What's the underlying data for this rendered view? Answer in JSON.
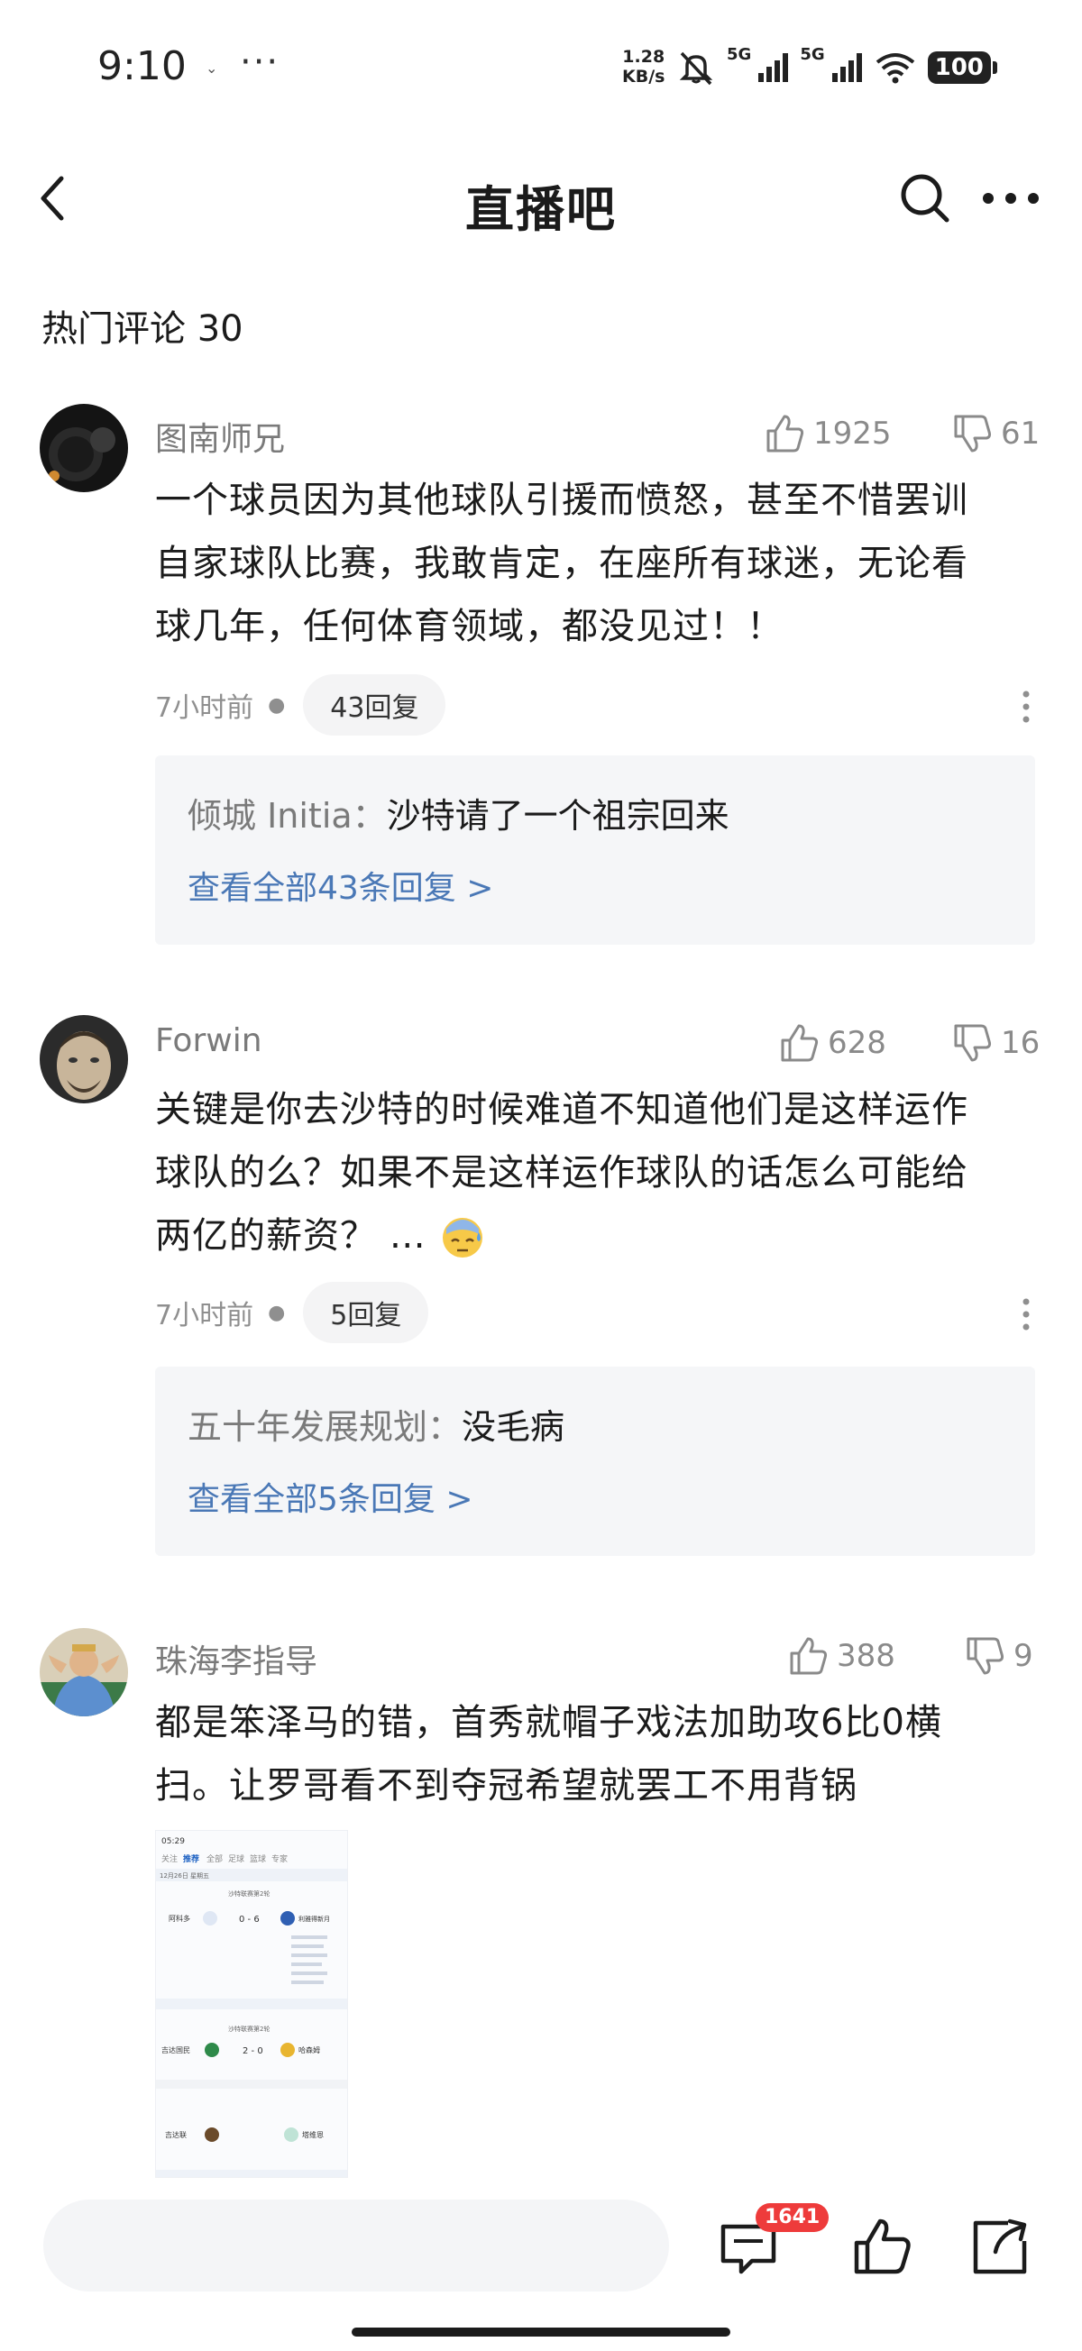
{
  "status": {
    "time": "9:10",
    "small_icon": "⌄",
    "dots": "···",
    "net_speed_value": "1.28",
    "net_speed_unit": "KB/s",
    "sig1": "5G",
    "sig2": "5G",
    "battery": "100"
  },
  "nav": {
    "title": "直播吧"
  },
  "section": {
    "title": "热门评论 30"
  },
  "comments": [
    {
      "username": "图南师兄",
      "likes": "1925",
      "dislikes": "61",
      "lines": [
        "一个球员因为其他球队引援而愤怒，甚至不惜罢训",
        "自家球队比赛，我敢肯定，在座所有球迷，无论看",
        "球几年，任何体育领域，都没见过！！"
      ],
      "time": "7小时前",
      "replies": "43回复",
      "reply_author": "倾城 Initia：",
      "reply_text": "沙特请了一个祖宗回来",
      "view_all": "查看全部43条回复 >"
    },
    {
      "username": "Forwin",
      "likes": "628",
      "dislikes": "16",
      "lines": [
        "关键是你去沙特的时候难道不知道他们是这样运作",
        "球队的么？如果不是这样运作球队的话怎么可能给",
        "两亿的薪资？ …"
      ],
      "time": "7小时前",
      "replies": "5回复",
      "reply_author": "五十年发展规划：",
      "reply_text": "没毛病",
      "view_all": "查看全部5条回复 >"
    },
    {
      "username": "珠海李指导",
      "likes": "388",
      "dislikes": "9",
      "lines": [
        "都是笨泽马的错，首秀就帽子戏法加助攻6比0横",
        "扫。让罗哥看不到夺冠希望就罢工不用背锅"
      ]
    }
  ],
  "thumbnail": {
    "time": "05:29",
    "tabs": [
      "关注",
      "推荐",
      "全部",
      "足球",
      "篮球",
      "专家"
    ],
    "date": "12月26日 星期五",
    "league": "沙特联赛第2轮",
    "match1": {
      "home": "阿科多",
      "score": "0 - 6",
      "away": "利雅得新月"
    },
    "match2": {
      "home": "吉达国民",
      "score": "2 - 0",
      "away": "哈森姆"
    },
    "match3": {
      "home": "吉达联",
      "away": "塔维恩"
    }
  },
  "bottom": {
    "comment_count": "1641"
  },
  "colors": {
    "link": "#4a78b6",
    "badge": "#ee3b3b",
    "muted": "#7a7a7a"
  }
}
